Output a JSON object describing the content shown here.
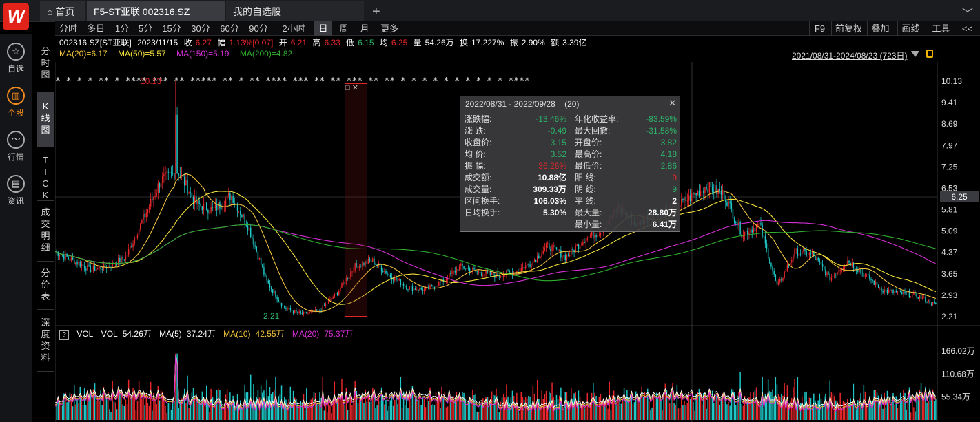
{
  "app": {
    "tabs": {
      "home": "首页",
      "stock": "F5-ST亚联 002316.SZ",
      "watchlist": "我的自选股",
      "add": "+"
    }
  },
  "sidebar": [
    {
      "label": "自选",
      "icon": "star-icon"
    },
    {
      "label": "个股",
      "icon": "chart-icon"
    },
    {
      "label": "行情",
      "icon": "trend-icon"
    },
    {
      "label": "资讯",
      "icon": "news-icon"
    }
  ],
  "vtabs": [
    "分时图",
    "K线图",
    "TICK",
    "成交明细",
    "分价表",
    "深度资料"
  ],
  "periods": [
    "分时",
    "多日",
    "1分",
    "5分",
    "15分",
    "30分",
    "60分",
    "90分",
    "2小时",
    "日",
    "周",
    "月",
    "更多"
  ],
  "right_tools": [
    "F9",
    "前复权",
    "叠加",
    "画线",
    "工具",
    "<<"
  ],
  "quote": {
    "code": "002316.SZ[ST亚联]",
    "date": "2023/11/15",
    "close_label": "收",
    "close": "6.27",
    "change_label": "幅",
    "change": "1.13%[0.07]",
    "open_label": "开",
    "open": "6.21",
    "high_label": "高",
    "high": "6.33",
    "low_label": "低",
    "low": "6.15",
    "avg_label": "均",
    "avg": "6.25",
    "volume_label": "量",
    "volume": "54.26万",
    "turnover_label": "换",
    "turnover": "17.227%",
    "amplitude_label": "振",
    "amplitude": "2.90%",
    "amount_label": "额",
    "amount": "3.39亿"
  },
  "ma_lines": [
    {
      "text": "MA(20)=6.17",
      "color": "#f2c53d"
    },
    {
      "text": "MA(50)=5.57",
      "color": "#f5e23a"
    },
    {
      "text": "MA(150)=5.19",
      "color": "#d630d6"
    },
    {
      "text": "MA(200)=4.82",
      "color": "#2fae2f"
    }
  ],
  "date_range": "2021/08/31-2024/08/23 (723日)",
  "price_axis": [
    "10.13",
    "9.41",
    "8.69",
    "7.97",
    "7.25",
    "6.53",
    "5.81",
    "5.09",
    "4.37",
    "3.65",
    "2.93",
    "2.21"
  ],
  "current_price": "6.25",
  "chart_labels": {
    "high": "10.13",
    "low": "2.21"
  },
  "volume_header": {
    "help": "?",
    "title": "VOL",
    "vol": "VOL=54.26万",
    "ma5": "MA(5)=37.24万",
    "ma10": "MA(10)=42.55万",
    "ma20": "MA(20)=75.37万"
  },
  "volume_axis": [
    "166.02万",
    "110.68万",
    "55.34万"
  ],
  "popup": {
    "range": "2022/08/31 - 2022/09/28",
    "count": "(20)",
    "left": [
      {
        "label": "涨跌幅:",
        "value": "-13.46%",
        "color": "#2db36a"
      },
      {
        "label": "涨  跌:",
        "value": "-0.49",
        "color": "#2db36a"
      },
      {
        "label": "收盘价:",
        "value": "3.15",
        "color": "#2db36a"
      },
      {
        "label": "均  价:",
        "value": "3.52",
        "color": "#2db36a"
      },
      {
        "label": "振  幅:",
        "value": "36.26%",
        "color": "#e5262a"
      },
      {
        "label": "成交额:",
        "value": "10.88亿",
        "color": "#ffffff"
      },
      {
        "label": "成交量:",
        "value": "309.33万",
        "color": "#ffffff"
      },
      {
        "label": "区间换手:",
        "value": "106.03%",
        "color": "#ffffff"
      },
      {
        "label": "日均换手:",
        "value": "5.30%",
        "color": "#ffffff"
      }
    ],
    "right": [
      {
        "label": "年化收益率:",
        "value": "-83.59%",
        "color": "#2db36a"
      },
      {
        "label": "最大回撤:",
        "value": "-31.58%",
        "color": "#2db36a"
      },
      {
        "label": "开盘价:",
        "value": "3.82",
        "color": "#2db36a"
      },
      {
        "label": "最高价:",
        "value": "4.18",
        "color": "#2db36a"
      },
      {
        "label": "最低价:",
        "value": "2.86",
        "color": "#2db36a"
      },
      {
        "label": "阳  线:",
        "value": "9",
        "color": "#e5262a"
      },
      {
        "label": "阴  线:",
        "value": "9",
        "color": "#2db36a"
      },
      {
        "label": "平  线:",
        "value": "2",
        "color": "#ffffff"
      },
      {
        "label": "最大量:",
        "value": "28.80万",
        "color": "#ffffff"
      },
      {
        "label": "最小量:",
        "value": "6.41万",
        "color": "#ffffff"
      }
    ]
  },
  "colors": {
    "up": "#e5262a",
    "down": "#1fc7c7",
    "ma20": "#f2c53d",
    "ma50": "#f5e23a",
    "ma150": "#d630d6",
    "ma200": "#2fae2f"
  },
  "chart_data": {
    "type": "candlestick",
    "title": "",
    "y_axis_ticks": [
      10.13,
      9.41,
      8.69,
      7.97,
      7.25,
      6.53,
      5.81,
      5.09,
      4.37,
      3.65,
      2.93,
      2.21
    ],
    "approx_close_path": [
      4.4,
      4.1,
      3.8,
      3.9,
      4.2,
      5.5,
      6.8,
      7.1,
      6.0,
      5.8,
      6.3,
      5.2,
      3.4,
      2.5,
      2.3,
      2.4,
      3.0,
      3.9,
      4.1,
      3.6,
      3.2,
      3.1,
      3.4,
      3.9,
      3.7,
      3.6,
      3.7,
      4.0,
      4.6,
      4.2,
      4.8,
      5.1,
      5.9,
      5.3,
      5.7,
      5.8,
      6.2,
      6.6,
      6.3,
      5.0,
      5.3,
      3.2,
      4.4,
      4.3,
      3.5,
      4.1,
      3.6,
      3.1,
      3.0,
      2.9,
      2.6
    ]
  }
}
